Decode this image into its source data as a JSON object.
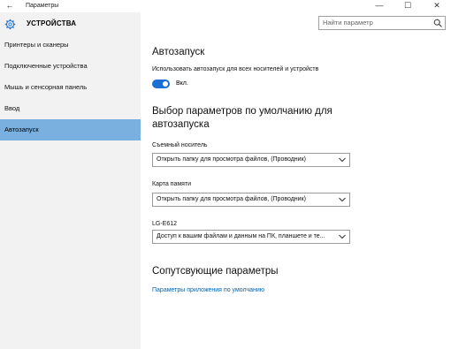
{
  "window": {
    "back_glyph": "←",
    "title": "Параметры",
    "min_glyph": "—",
    "max_glyph": "☐",
    "close_glyph": "✕"
  },
  "sidebar": {
    "header_label": "УСТРОЙСТВА",
    "items": [
      {
        "label": "Принтеры и сканеры",
        "active": false
      },
      {
        "label": "Подключенные устройства",
        "active": false
      },
      {
        "label": "Мышь и сенсорная панель",
        "active": false
      },
      {
        "label": "Ввод",
        "active": false
      },
      {
        "label": "Автозапуск",
        "active": true
      }
    ]
  },
  "search": {
    "placeholder": "Найти параметр",
    "icon": "search-icon"
  },
  "main": {
    "autoplay_title": "Автозапуск",
    "autoplay_desc": "Использовать автозапуск для всех носителей и устройств",
    "toggle_state": "Вкл.",
    "toggle_on": true,
    "defaults_title_line1": "Выбор параметров по умолчанию для",
    "defaults_title_line2": "автозапуска",
    "devices": [
      {
        "label": "Съемный носитель",
        "value": "Открыть папку для просмотра файлов, (Проводник)"
      },
      {
        "label": "Карта памяти",
        "value": "Открыть папку для просмотра файлов, (Проводник)"
      },
      {
        "label": "LG-E612",
        "value": "Доступ к вашим файлам и данным на ПК, планшете и те..."
      }
    ],
    "related_title": "Сопутсвующие параметры",
    "related_link": "Параметры приложения по умолчанию"
  },
  "colors": {
    "accent": "#1a6fd4",
    "active_item": "#7ab0e0",
    "link": "#0063b1",
    "sidebar_bg": "#f2f2f2"
  }
}
